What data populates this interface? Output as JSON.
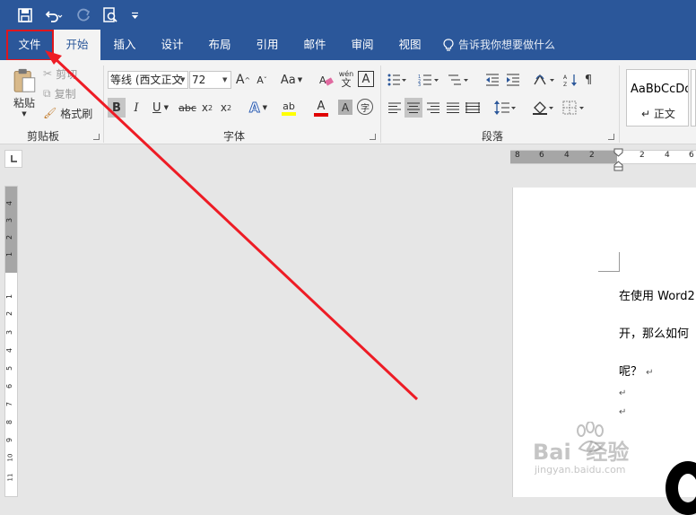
{
  "quick_access": {
    "save_icon": "save-icon",
    "undo_icon": "undo-icon",
    "redo_icon": "redo-icon",
    "print_preview_icon": "print-preview-icon",
    "customize_icon": "customize-icon"
  },
  "tabs": [
    {
      "label": "文件"
    },
    {
      "label": "开始"
    },
    {
      "label": "插入"
    },
    {
      "label": "设计"
    },
    {
      "label": "布局"
    },
    {
      "label": "引用"
    },
    {
      "label": "邮件"
    },
    {
      "label": "审阅"
    },
    {
      "label": "视图"
    }
  ],
  "tell_me": "告诉我你想要做什么",
  "clipboard": {
    "paste": "粘贴",
    "cut": "剪切",
    "copy": "复制",
    "format_painter": "格式刷",
    "group_label": "剪贴板"
  },
  "font": {
    "font_name": "等线 (西文正文",
    "font_size": "72",
    "aa": "Aa",
    "group_label": "字体",
    "wen": "wén",
    "zi": "字",
    "a_box": "A"
  },
  "paragraph": {
    "group_label": "段落"
  },
  "styles": {
    "style_preview": "AaBbCcDd",
    "style_name": "正文"
  },
  "ruler": {
    "ticks": [
      "8",
      "6",
      "4",
      "2",
      "2",
      "4",
      "6"
    ]
  },
  "vruler": {
    "ticks": [
      "4",
      "3",
      "2",
      "1",
      "1",
      "2",
      "3",
      "4",
      "5",
      "6",
      "7",
      "8",
      "9",
      "10",
      "11"
    ]
  },
  "document": {
    "lines": [
      "在使用 Word2",
      "开，那么如何",
      "呢？"
    ],
    "para_mark": "↵"
  },
  "watermark": {
    "brand": "Bai  经验",
    "url": "jingyan.baidu.com"
  }
}
